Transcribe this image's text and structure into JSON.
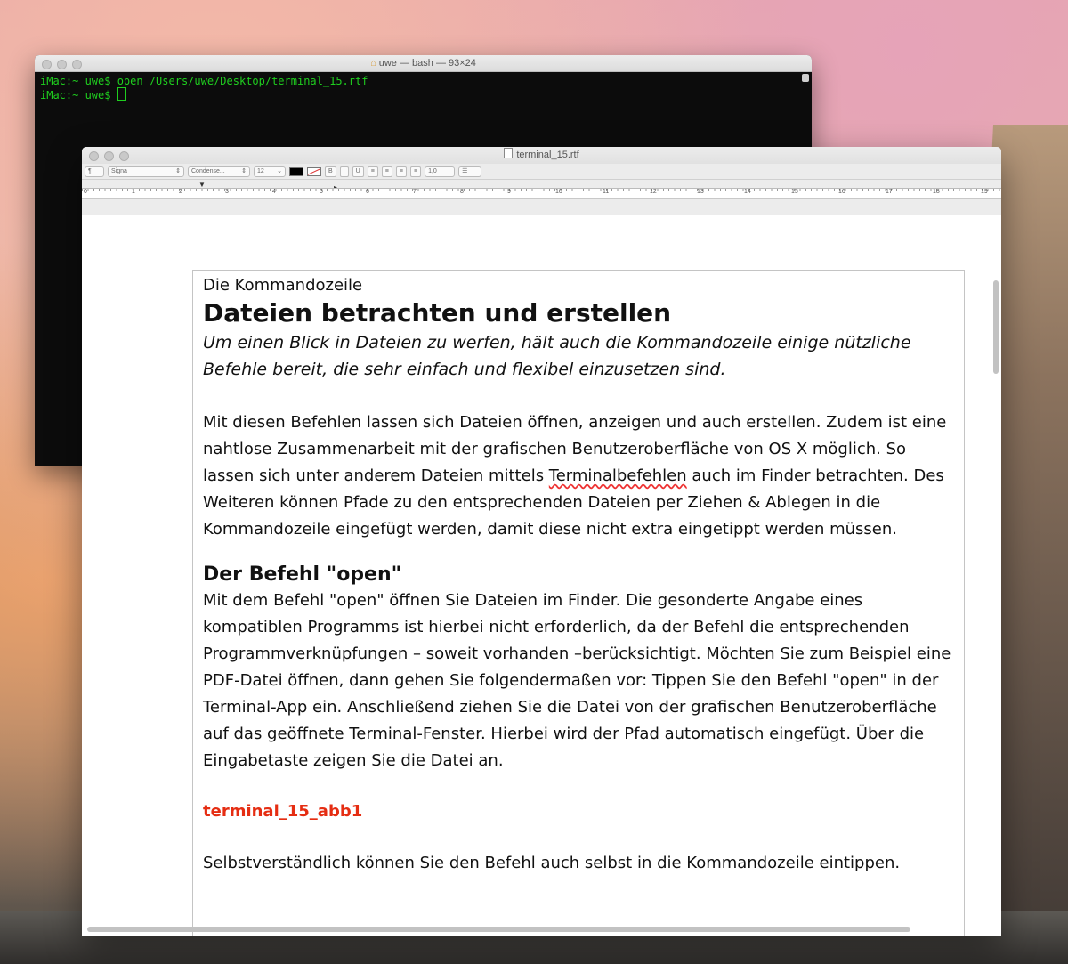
{
  "terminal": {
    "title": "uwe — bash — 93×24",
    "title_icon": "home-icon",
    "lines": [
      "iMac:~ uwe$ open /Users/uwe/Desktop/terminal_15.rtf",
      "iMac:~ uwe$ "
    ],
    "text_color": "#1fce1f"
  },
  "textedit": {
    "title": "terminal_15.rtf",
    "toolbar": {
      "paragraph_style": "¶",
      "font_family": "Signa",
      "font_style": "Condense...",
      "font_size": "12",
      "bold": "B",
      "italic": "I",
      "underline": "U",
      "line_spacing": "1,0",
      "list": "☰"
    },
    "ruler_numbers": [
      "0",
      "1",
      "2",
      "3",
      "4",
      "5",
      "6",
      "7",
      "8",
      "9",
      "10",
      "11",
      "12",
      "13",
      "14",
      "15",
      "16",
      "17",
      "18",
      "19"
    ],
    "document": {
      "kicker": "Die Kommandozeile",
      "title": "Dateien betrachten und erstellen",
      "lead": "Um einen Blick in Dateien zu werfen, hält auch die Kommandozeile einige nützliche Befehle bereit, die sehr einfach und flexibel einzusetzen sind.",
      "p1_before": "Mit diesen Befehlen lassen sich Dateien öffnen, anzeigen und auch erstellen. Zudem ist eine nahtlose Zusammenarbeit mit der grafischen Benutzeroberfläche von OS X möglich. So lassen sich unter anderem Dateien mittels ",
      "p1_misspelled": "Terminalbefehlen",
      "p1_after": " auch im Finder betrachten. Des Weiteren können Pfade zu den entsprechenden Dateien per Ziehen & Ablegen in die Kommandozeile eingefügt werden, damit diese nicht extra eingetippt werden müssen.",
      "h2": "Der Befehl \"open\"",
      "p2": "Mit dem Befehl \"open\" öffnen Sie Dateien im Finder. Die gesonderte Angabe eines kompatiblen Programms ist hierbei nicht erforderlich, da der Befehl die entsprechenden Programmverknüpfungen – soweit vorhanden –berücksichtigt. Möchten Sie zum Beispiel eine PDF-Datei öffnen, dann gehen Sie folgendermaßen vor: Tippen Sie den Befehl \"open\" in der Terminal-App ein. Anschließend ziehen Sie die Datei von der grafischen Benutzeroberfläche auf das geöffnete Terminal-Fenster. Hierbei wird der Pfad automatisch eingefügt. Über die Eingabetaste zeigen Sie die Datei an.",
      "figure_label": "terminal_15_abb1",
      "figure_color": "#e52d12",
      "p3": "Selbstverständlich können Sie den Befehl auch selbst in die Kommandozeile eintippen."
    }
  }
}
